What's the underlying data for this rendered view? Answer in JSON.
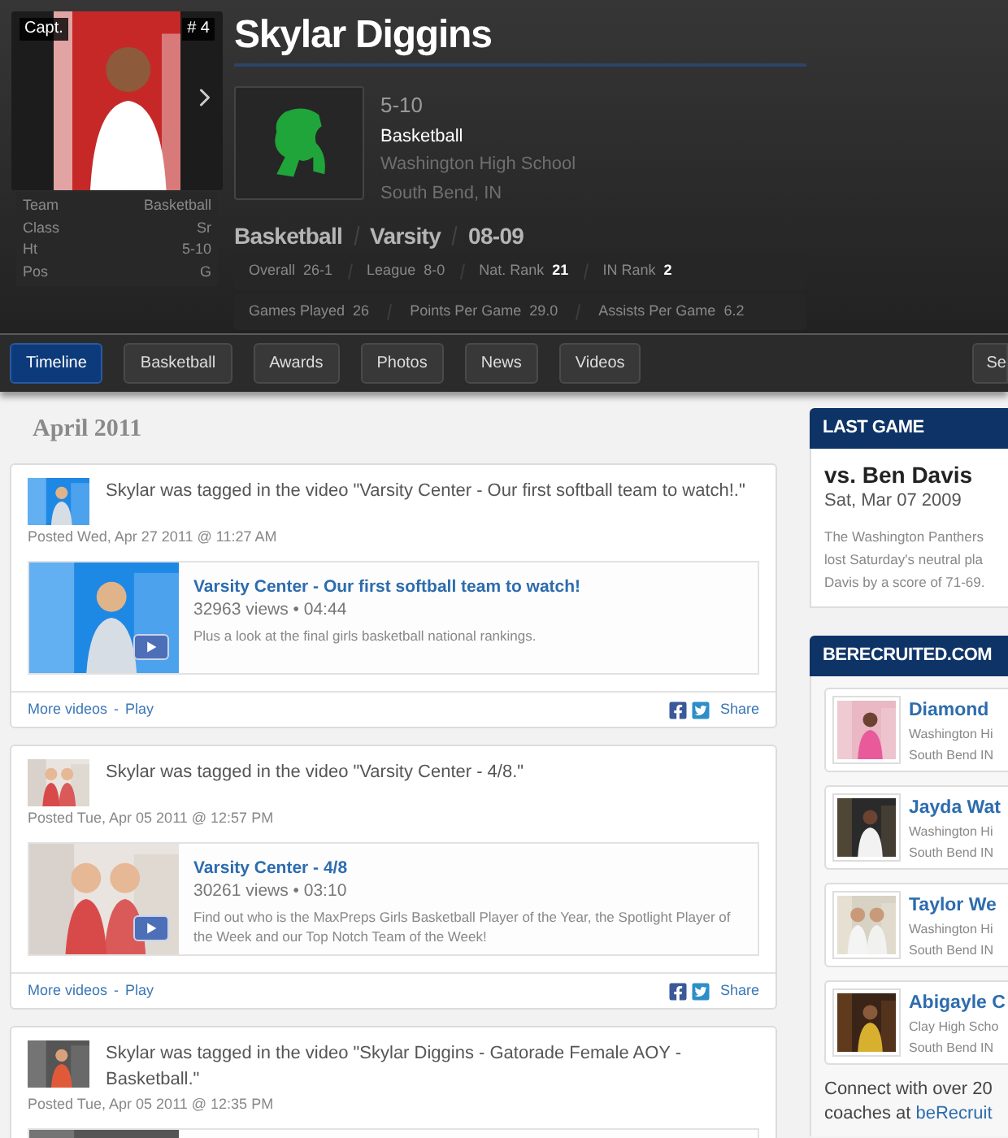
{
  "player": {
    "badge": "Capt.",
    "number": "# 4",
    "name": "Skylar Diggins",
    "bio": [
      {
        "label": "Team",
        "value": "Basketball"
      },
      {
        "label": "Class",
        "value": "Sr"
      },
      {
        "label": "Ht",
        "value": "5-10"
      },
      {
        "label": "Pos",
        "value": "G"
      }
    ]
  },
  "profile": {
    "height": "5-10",
    "sport": "Basketball",
    "school": "Washington High School",
    "location": "South Bend, IN"
  },
  "season": [
    "Basketball",
    "Varsity",
    "08-09"
  ],
  "record": [
    {
      "label": "Overall",
      "value": "26-1",
      "bold": false
    },
    {
      "label": "League",
      "value": "8-0",
      "bold": false
    },
    {
      "label": "Nat. Rank",
      "value": "21",
      "bold": true
    },
    {
      "label": "IN Rank",
      "value": "2",
      "bold": true
    }
  ],
  "stats": [
    {
      "label": "Games Played",
      "value": "26"
    },
    {
      "label": "Points Per Game",
      "value": "29.0"
    },
    {
      "label": "Assists Per Game",
      "value": "6.2"
    }
  ],
  "tabs": [
    {
      "label": "Timeline",
      "selected": true
    },
    {
      "label": "Basketball",
      "selected": false
    },
    {
      "label": "Awards",
      "selected": false
    },
    {
      "label": "Photos",
      "selected": false
    },
    {
      "label": "News",
      "selected": false
    },
    {
      "label": "Videos",
      "selected": false
    },
    {
      "label": "Se",
      "selected": false
    }
  ],
  "feed": {
    "heading": "April 2011",
    "posts": [
      {
        "text": "Skylar was tagged in the video \"Varsity Center - Our first softball team to watch!.\"",
        "posted": "Posted Wed, Apr 27 2011 @ 11:27 AM",
        "links": [
          "More videos",
          "Play"
        ],
        "link_separator": "-",
        "share": "Share",
        "video": {
          "title": "Varsity Center - Our first softball team to watch!",
          "meta": "32963 views • 04:44",
          "description": "Plus a look at the final girls basketball national rankings."
        }
      },
      {
        "text": "Skylar was tagged in the video \"Varsity Center - 4/8.\"",
        "posted": "Posted Tue, Apr 05 2011 @ 12:57 PM",
        "links": [
          "More videos",
          "Play"
        ],
        "link_separator": "-",
        "share": "Share",
        "video": {
          "title": "Varsity Center - 4/8",
          "meta": "30261 views • 03:10",
          "description": "Find out who is the MaxPreps Girls Basketball Player of the Year, the Spotlight Player of the Week and our Top Notch Team of the Week!"
        }
      },
      {
        "text": "Skylar was tagged in the video \"Skylar Diggins - Gatorade Female AOY - Basketball.\"",
        "posted": "Posted Tue, Apr 05 2011 @ 12:35 PM"
      }
    ]
  },
  "last_game": {
    "heading": "LAST GAME",
    "opponent": "vs. Ben Davis",
    "date": "Sat, Mar 07 2009",
    "summary": [
      "The Washington Panthers",
      "lost Saturday's neutral pla",
      "Davis by a score of 71-69."
    ]
  },
  "recruits": {
    "heading": "BERECRUITED.COM",
    "items": [
      {
        "name": "Diamond",
        "school": "Washington Hi",
        "location": "South Bend IN"
      },
      {
        "name": "Jayda Wat",
        "school": "Washington Hi",
        "location": "South Bend IN"
      },
      {
        "name": "Taylor We",
        "school": "Washington Hi",
        "location": "South Bend IN"
      },
      {
        "name": "Abigayle C",
        "school": "Clay High Scho",
        "location": "South Bend IN"
      }
    ],
    "connect": "Connect with over 20",
    "connect_prefix": "coaches at",
    "connect_link": "beRecruit"
  }
}
